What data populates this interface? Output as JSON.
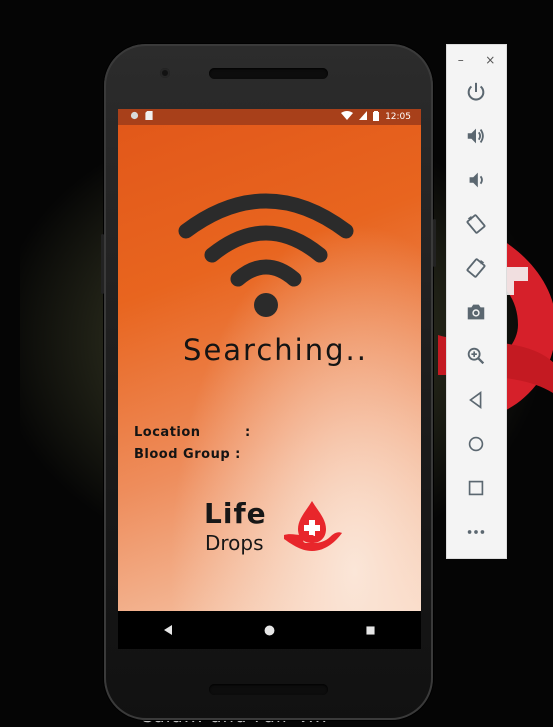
{
  "status_bar": {
    "time": "12:05"
  },
  "app": {
    "status_text": "Searching..",
    "location_label": "Location",
    "location_colon": ":",
    "blood_group_label": "Blood Group :",
    "logo": {
      "line1": "Life",
      "line2": "Drops"
    }
  },
  "emulator_panel": {
    "window_controls": [
      "–",
      "×"
    ],
    "tools": [
      {
        "name": "power-icon"
      },
      {
        "name": "volume-up-icon"
      },
      {
        "name": "volume-down-icon"
      },
      {
        "name": "rotate-left-icon"
      },
      {
        "name": "rotate-right-icon"
      },
      {
        "name": "camera-icon"
      },
      {
        "name": "zoom-icon"
      },
      {
        "name": "back-icon"
      },
      {
        "name": "home-icon"
      },
      {
        "name": "overview-icon"
      },
      {
        "name": "more-icon"
      }
    ]
  },
  "background": {
    "caption": "Caia... and Fair V..."
  },
  "colors": {
    "app_orange": "#e2581a",
    "logo_red": "#e8262b",
    "text_dark": "#141414",
    "panel_icon": "#5b6770"
  }
}
